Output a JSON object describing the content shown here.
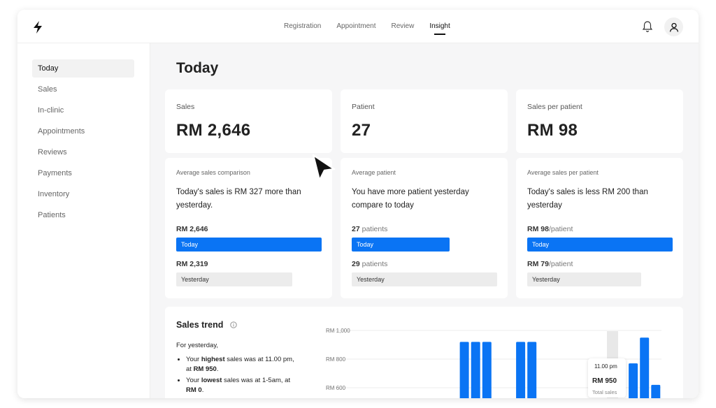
{
  "topbar": {
    "nav": [
      "Registration",
      "Appointment",
      "Review",
      "Insight"
    ],
    "active_nav": "Insight"
  },
  "sidebar": {
    "items": [
      "Today",
      "Sales",
      "In-clinic",
      "Appointments",
      "Reviews",
      "Payments",
      "Inventory",
      "Patients"
    ],
    "active": "Today"
  },
  "page": {
    "title": "Today"
  },
  "stats": [
    {
      "label": "Sales",
      "value": "RM 2,646"
    },
    {
      "label": "Patient",
      "value": "27"
    },
    {
      "label": "Sales per patient",
      "value": "RM 98"
    }
  ],
  "comparisons": [
    {
      "label": "Average sales comparison",
      "text": "Today's sales is RM 327 more than yesterday.",
      "today_value": "RM 2,646",
      "today_unit": "",
      "today_label": "Today",
      "yesterday_value": "RM 2,319",
      "yesterday_unit": "",
      "yesterday_label": "Yesterday"
    },
    {
      "label": "Average patient",
      "text": "You have more patient yesterday compare to today",
      "today_value": "27",
      "today_unit": " patients",
      "today_label": "Today",
      "yesterday_value": "29",
      "yesterday_unit": " patients",
      "yesterday_label": "Yesterday"
    },
    {
      "label": "Average sales per patient",
      "text": "Today's sales is less RM 200 than yesterday",
      "today_value": "RM 98",
      "today_unit": "/patient",
      "today_label": "Today",
      "yesterday_value": "RM 79",
      "yesterday_unit": "/patient",
      "yesterday_label": "Yesterday"
    }
  ],
  "trend": {
    "title": "Sales trend",
    "intro": "For yesterday,",
    "highest_pre": "Your ",
    "highest_bold": "highest",
    "highest_mid": " sales was at 11.00 pm, at ",
    "highest_val": "RM 950",
    "highest_end": ".",
    "lowest_pre": "Your ",
    "lowest_bold": "lowest",
    "lowest_mid": " sales was at 1-5am, at ",
    "lowest_val": "RM 0",
    "lowest_end": ".",
    "tooltip": {
      "time": "11.00 pm",
      "value": "RM 950",
      "label": "Total sales"
    }
  },
  "chart_data": {
    "type": "bar",
    "yticks": [
      "RM 1,000",
      "RM 800",
      "RM 600"
    ],
    "ylim": [
      0,
      1000
    ],
    "values": [
      0,
      0,
      0,
      0,
      0,
      0,
      920,
      920,
      920,
      0,
      0,
      920,
      920,
      0,
      0,
      0,
      0,
      0,
      0,
      0,
      0,
      770,
      950,
      620
    ],
    "bar_color": "#0a74f4",
    "highlight_index": 21
  }
}
